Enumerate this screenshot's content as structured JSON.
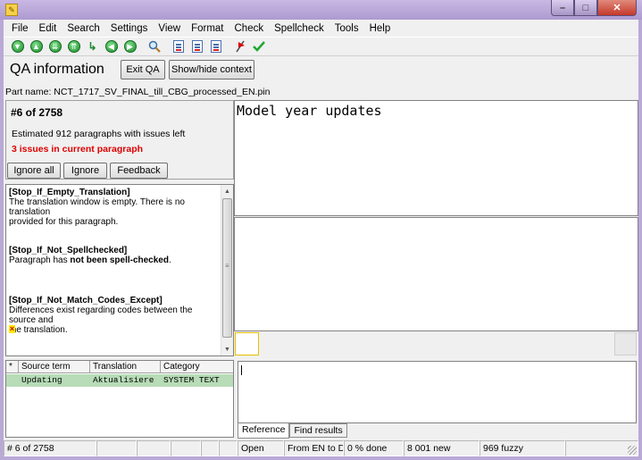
{
  "menu": [
    "File",
    "Edit",
    "Search",
    "Settings",
    "View",
    "Format",
    "Check",
    "Spellcheck",
    "Tools",
    "Help"
  ],
  "toolbar": {
    "icons": [
      "down-arrow-icon",
      "up-arrow-icon",
      "double-down-icon",
      "double-up-icon",
      "jump-icon",
      "left-arrow-icon",
      "right-arrow-icon",
      "search-icon",
      "doc-icon-1",
      "doc-icon-2",
      "doc-icon-3",
      "stop-icon",
      "check-icon"
    ]
  },
  "qa": {
    "title": "QA information",
    "exit_label": "Exit QA",
    "context_label": "Show/hide context",
    "part_name": "Part name: NCT_1717_SV_FINAL_till_CBG_processed_EN.pin",
    "counter": "#6 of 2758",
    "estimated": "Estimated 912 paragraphs with issues left",
    "issues_current": "3 issues in current paragraph",
    "ignore_all_label": "Ignore all",
    "ignore_label": "Ignore",
    "feedback_label": "Feedback"
  },
  "issues": [
    {
      "rule": "[Stop_If_Empty_Translation]",
      "line1": "The translation window is empty. There is no translation",
      "line2": "provided for this paragraph."
    },
    {
      "rule": "[Stop_If_Not_Spellchecked]",
      "pre": "Paragraph has ",
      "bold": "not been spell-checked",
      "post": "."
    },
    {
      "rule": "[Stop_If_Not_Match_Codes_Except]",
      "line1": "Differences exist regarding codes between the source and",
      "line2": "the translation."
    }
  ],
  "issue_marker": "×",
  "terms": {
    "headers": [
      "*",
      "Source term",
      "Translation",
      "Category"
    ],
    "rows": [
      {
        "star": "",
        "source": "Updating",
        "translation": "Aktualisiere",
        "category": "SYSTEM TEXT"
      }
    ]
  },
  "editor": {
    "source_text": "Model year updates"
  },
  "tabs": [
    "Reference",
    "Find results"
  ],
  "status": [
    "# 6 of 2758",
    "",
    "",
    "",
    "",
    "",
    "Open",
    "From EN to DE",
    "0 % done",
    "8 001 new",
    "969 fuzzy",
    ""
  ],
  "colors": {
    "titlebar": "#b9a9d6",
    "issues_red": "#e00000",
    "term_row": "#b7dcb7",
    "close_button": "#c4392a"
  }
}
